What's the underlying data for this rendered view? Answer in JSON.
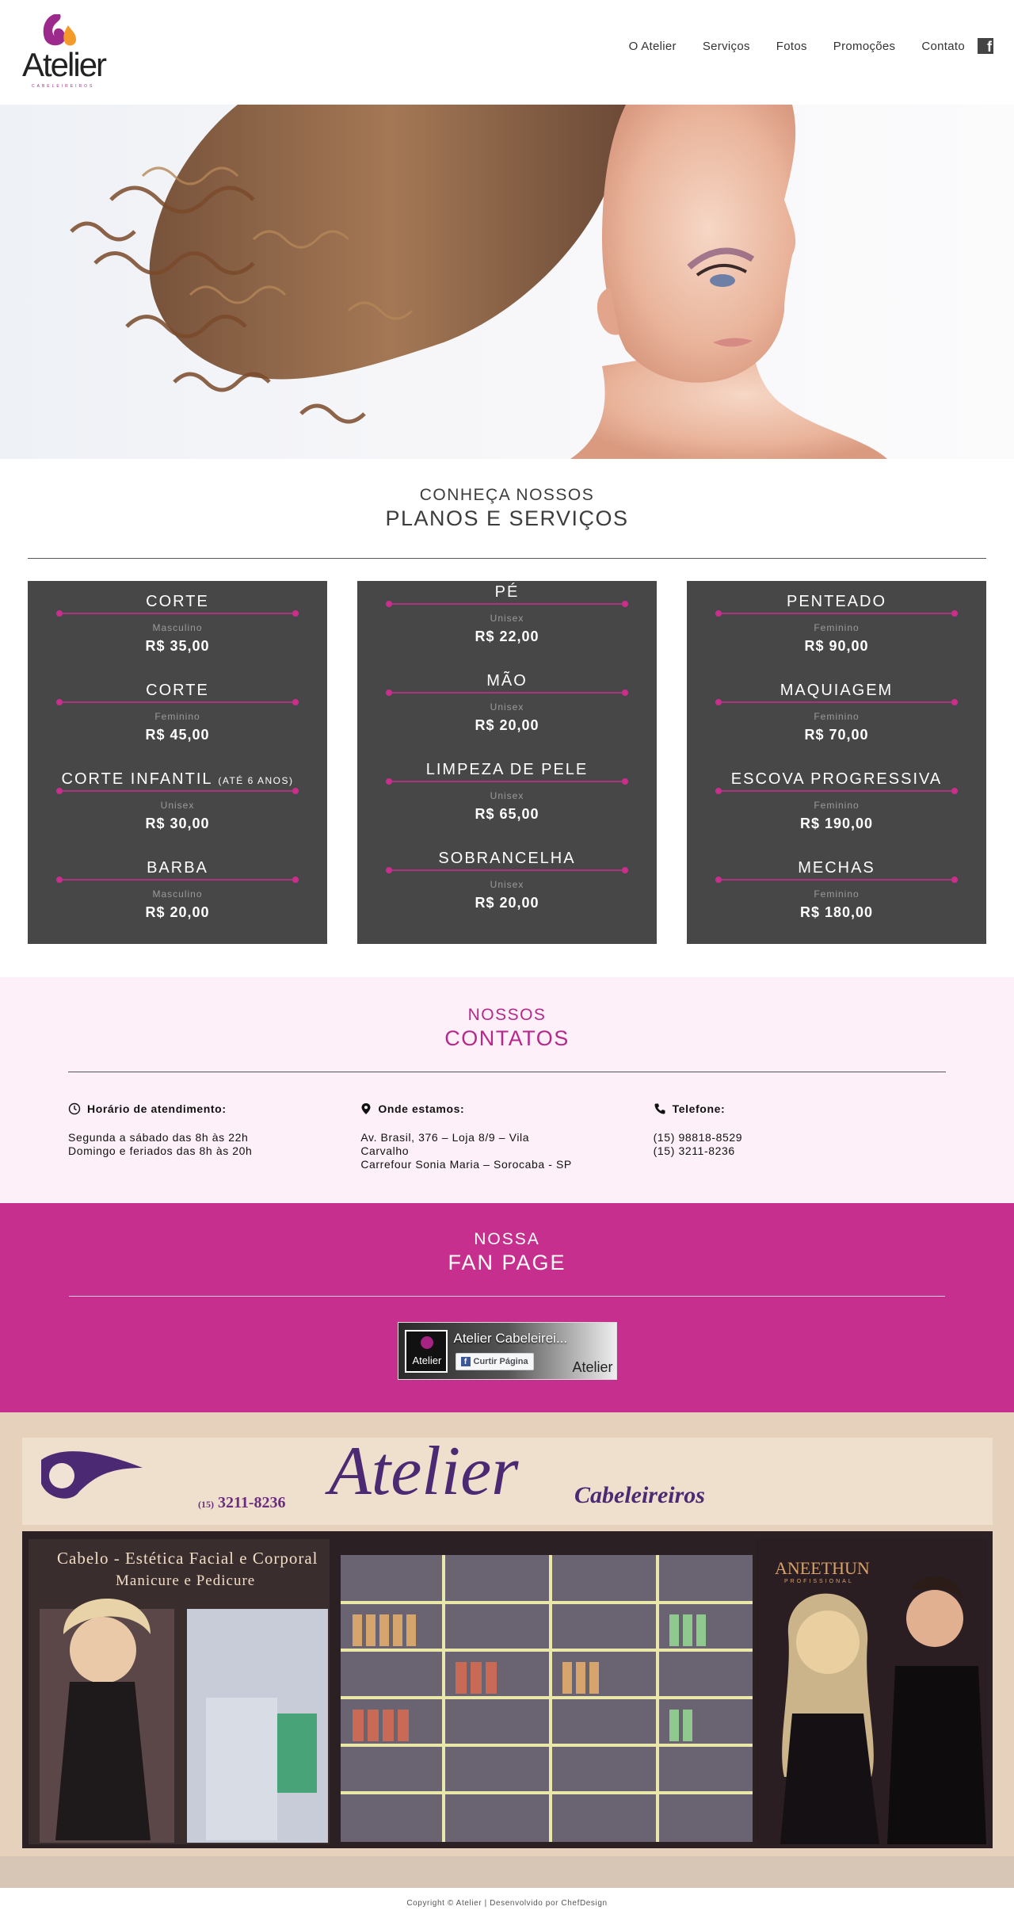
{
  "brand": {
    "name": "Atelier",
    "subtitle": "CABELEIREIROS"
  },
  "nav": {
    "items": [
      "O Atelier",
      "Serviços",
      "Fotos",
      "Promoções",
      "Contato"
    ],
    "social_icon": "facebook-icon"
  },
  "hero": {
    "image": "woman-curly-hair-photo"
  },
  "services": {
    "title_small": "CONHEÇA NOSSOS",
    "title_big": "PLANOS E SERVIÇOS",
    "columns": [
      {
        "items": [
          {
            "name": "CORTE",
            "note": "",
            "category": "Masculino",
            "price": "R$ 35,00"
          },
          {
            "name": "CORTE",
            "note": "",
            "category": "Feminino",
            "price": "R$ 45,00"
          },
          {
            "name": "CORTE INFANTIL",
            "note": "(ATÉ 6 ANOS)",
            "category": "Unisex",
            "price": "R$ 30,00"
          },
          {
            "name": "BARBA",
            "note": "",
            "category": "Masculino",
            "price": "R$ 20,00"
          }
        ]
      },
      {
        "items": [
          {
            "name": "PÉ",
            "note": "",
            "category": "Unisex",
            "price": "R$ 22,00"
          },
          {
            "name": "MÃO",
            "note": "",
            "category": "Unisex",
            "price": "R$ 20,00"
          },
          {
            "name": "LIMPEZA DE PELE",
            "note": "",
            "category": "Unisex",
            "price": "R$ 65,00"
          },
          {
            "name": "SOBRANCELHA",
            "note": "",
            "category": "Unisex",
            "price": "R$ 20,00"
          }
        ]
      },
      {
        "items": [
          {
            "name": "PENTEADO",
            "note": "",
            "category": "Feminino",
            "price": "R$ 90,00"
          },
          {
            "name": "MAQUIAGEM",
            "note": "",
            "category": "Feminino",
            "price": "R$ 70,00"
          },
          {
            "name": "ESCOVA PROGRESSIVA",
            "note": "",
            "category": "Feminino",
            "price": "R$ 190,00"
          },
          {
            "name": "MECHAS",
            "note": "",
            "category": "Feminino",
            "price": "R$ 180,00"
          }
        ]
      }
    ]
  },
  "contacts": {
    "title_small": "NOSSOS",
    "title_big": "CONTATOS",
    "hours": {
      "heading": "Horário de atendimento:",
      "icon": "clock-icon",
      "lines": [
        "Segunda a sábado das 8h às 22h",
        "Domingo e feriados das 8h às 20h"
      ]
    },
    "location": {
      "heading": "Onde estamos:",
      "icon": "map-pin-icon",
      "lines": [
        "Av. Brasil, 376 – Loja 8/9 – Vila",
        "Carvalho",
        "Carrefour Sonia Maria – Sorocaba - SP"
      ]
    },
    "phone": {
      "heading": "Telefone:",
      "icon": "phone-icon",
      "lines": [
        "(15) 98818-8529",
        "(15) 3211-8236"
      ]
    }
  },
  "fanpage": {
    "title_small": "NOSSA",
    "title_big": "FAN PAGE",
    "widget_name": "Atelier Cabeleirei...",
    "like_label": "Curtir Página",
    "avatar_text": "Atelier",
    "logo_text": "Atelier"
  },
  "storefront": {
    "sign_brand": "Atelier",
    "sign_sub": "Cabeleireiros",
    "phone_prefix": "(15)",
    "phone": "3211-8236",
    "services_line1": "Cabelo - Estética Facial e Corporal",
    "services_line2": "Manicure e Pedicure",
    "poster_brand": "ANEETHUN",
    "poster_sub": "PROFISSIONAL"
  },
  "footer": {
    "text": "Copyright © Atelier | Desenvolvido por ChefDesign"
  },
  "colors": {
    "accent": "#c72f8f",
    "card_bg": "#474747",
    "contacts_bg": "#fdf0f8"
  }
}
